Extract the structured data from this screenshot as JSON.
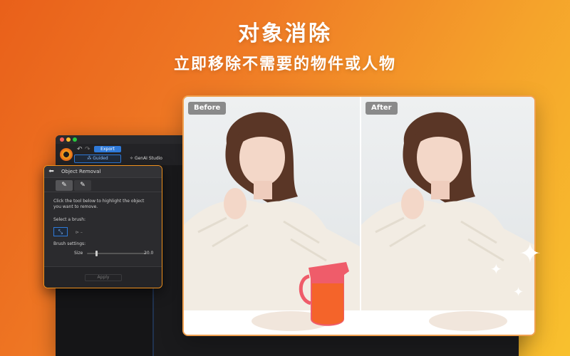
{
  "banner": {
    "title": "对象消除",
    "subtitle": "立即移除不需要的物件或人物"
  },
  "app": {
    "toolbar": {
      "undo_glyph": "↶",
      "redo_glyph": "↷",
      "export_label": "Export",
      "tabs": [
        {
          "label": "Guided",
          "icon": "wand-icon",
          "active": true
        },
        {
          "label": "GenAI Studio",
          "icon": "sparkle-icon",
          "active": false
        }
      ]
    },
    "panel": {
      "title": "Object Removal",
      "brush_tabs": [
        {
          "icon": "smart-brush-icon",
          "glyph": "✎",
          "active": true
        },
        {
          "icon": "manual-brush-icon",
          "glyph": "✎",
          "active": false
        }
      ],
      "instructions_line1": "Click the tool below to highlight the object",
      "instructions_line2": "you want to remove.",
      "select_brush_label": "Select a brush:",
      "brush_alt": "⊳ –",
      "brush_settings_label": "Brush settings:",
      "size_label": "Size",
      "size_value": "20.0",
      "size_slider_fraction": 0.15,
      "apply_label": "Apply"
    }
  },
  "comparison": {
    "before_label": "Before",
    "after_label": "After",
    "removed_object": "orange-pitcher"
  },
  "colors": {
    "accent_orange": "#f0911d",
    "accent_blue": "#2f7ad9",
    "background_start": "#e9601a",
    "background_end": "#f8c12e"
  }
}
